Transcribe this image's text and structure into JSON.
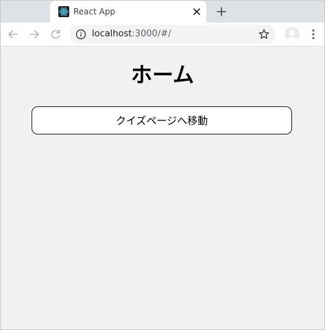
{
  "browser": {
    "tab": {
      "title": "React App",
      "favicon": "react-logo-icon"
    },
    "new_tab_icon": "plus-icon",
    "close_tab_icon": "close-icon",
    "toolbar": {
      "back_icon": "back-arrow-icon",
      "forward_icon": "forward-arrow-icon",
      "reload_icon": "reload-icon",
      "info_icon": "info-icon",
      "url_host": "localhost",
      "url_rest": ":3000/#/",
      "bookmark_icon": "star-icon",
      "profile_icon": "avatar",
      "menu_icon": "kebab-menu-icon"
    }
  },
  "page": {
    "title": "ホーム",
    "quiz_button_label": "クイズページへ移動"
  },
  "colors": {
    "page_background": "#f1f1f1",
    "tab_strip": "#dee1e6",
    "omnibox": "#f1f3f4",
    "button_border": "#1a1a1a"
  }
}
